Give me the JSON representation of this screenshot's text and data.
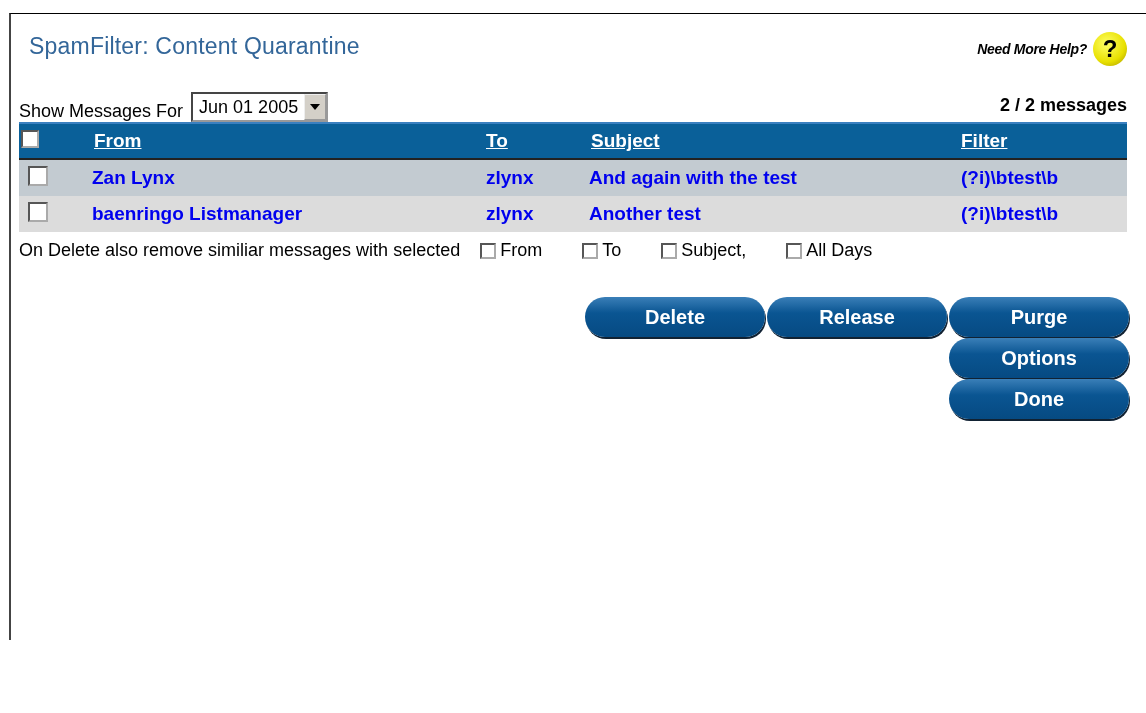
{
  "title": "SpamFilter: Content Quarantine",
  "help": {
    "label": "Need More Help?",
    "icon_text": "?"
  },
  "date_filter": {
    "label": "Show Messages For",
    "value": "Jun 01 2005"
  },
  "count": "2 / 2 messages",
  "table": {
    "select_all": {
      "checked": false
    },
    "columns": [
      "From",
      "To",
      "Subject",
      "Filter"
    ],
    "rows": [
      {
        "checked": false,
        "cells": [
          "Zan Lynx",
          "zlynx",
          "And again with the test",
          "(?i)\\btest\\b"
        ]
      },
      {
        "checked": false,
        "cells": [
          "baenringo Listmanager",
          "zlynx",
          "Another test",
          "(?i)\\btest\\b"
        ]
      }
    ]
  },
  "delete_options": {
    "label": "On Delete also remove similiar messages with selected",
    "options": [
      {
        "label": "From",
        "checked": false
      },
      {
        "label": "To",
        "checked": false
      },
      {
        "label": "Subject,",
        "checked": false
      },
      {
        "label": "All Days",
        "checked": false
      }
    ]
  },
  "buttons": [
    "Delete",
    "Release",
    "Purge",
    "Options",
    "Done"
  ]
}
